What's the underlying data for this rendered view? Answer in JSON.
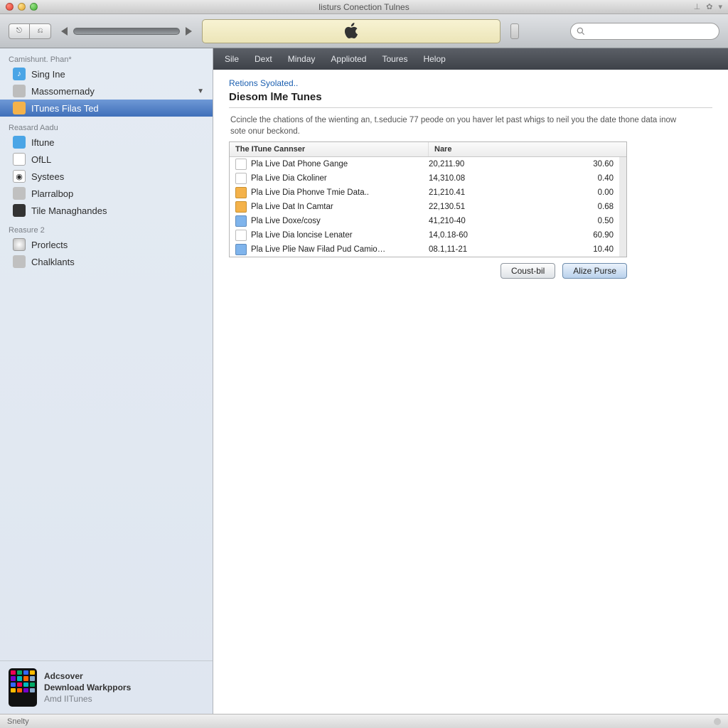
{
  "window": {
    "title": "listurs Conection Tulnes"
  },
  "toolbar": {
    "search_placeholder": ""
  },
  "sidebar": {
    "group1_header": "Camishunt. Phan*",
    "group1": [
      {
        "label": "Sing Ine"
      },
      {
        "label": "Massomernady"
      },
      {
        "label": "ITunes Filas Ted"
      }
    ],
    "group2_header": "Reasard Aadu",
    "group2": [
      {
        "label": "Iftune"
      },
      {
        "label": "OfLL"
      },
      {
        "label": "Systees"
      },
      {
        "label": "Plarralbop"
      },
      {
        "label": "Tile Managhandes"
      }
    ],
    "group3_header": "Reasure 2",
    "group3": [
      {
        "label": "Prorlects"
      },
      {
        "label": "Chalklants"
      }
    ],
    "bottom": {
      "line1": "Adcsover",
      "line2": "Dewnload Warkppors",
      "line3": "Amd IITunes"
    }
  },
  "menu": {
    "items": [
      "Sile",
      "Dext",
      "Minday",
      "Applioted",
      "Toures",
      "Helop"
    ]
  },
  "content": {
    "link": "Retions Syolated..",
    "title": "Diesom lMe Tunes",
    "blurb": "Ccincle the chations of the wienting an, t.seducie 77 peode on you haver let past whigs to neil you the date thone data inow sote onur beckond.",
    "header_col1": "The ITune Cannser",
    "header_col2": "Nare",
    "rows": [
      {
        "icon": "doc",
        "name": "Pla Live Dat Phone Gange",
        "mid": "20,211.90",
        "val": "30.60"
      },
      {
        "icon": "doc",
        "name": "Pla Live Dia Ckoliner",
        "mid": "14,310.08",
        "val": "0.40"
      },
      {
        "icon": "fold",
        "name": "Pla Live Dia Phonve Tmie Data..",
        "mid": "21,210.41",
        "val": "0.00"
      },
      {
        "icon": "fold",
        "name": "Pla Live Dat In Camtar",
        "mid": "22,130.51",
        "val": "0.68"
      },
      {
        "icon": "blue",
        "name": "Pla Live Doxe/cosy",
        "mid": "41,210-40",
        "val": "0.50"
      },
      {
        "icon": "doc",
        "name": "Pla Live Dia loncise Lenater",
        "mid": "14,0.18-60",
        "val": "60.90"
      },
      {
        "icon": "blue",
        "name": "Pla Live Plie Naw Filad Pud Camio…",
        "mid": "08.1,11-21",
        "val": "10.40"
      }
    ],
    "btn_cancel": "Coust-bil",
    "btn_ok": "Alize Purse"
  },
  "status": {
    "left": "Snelty"
  }
}
